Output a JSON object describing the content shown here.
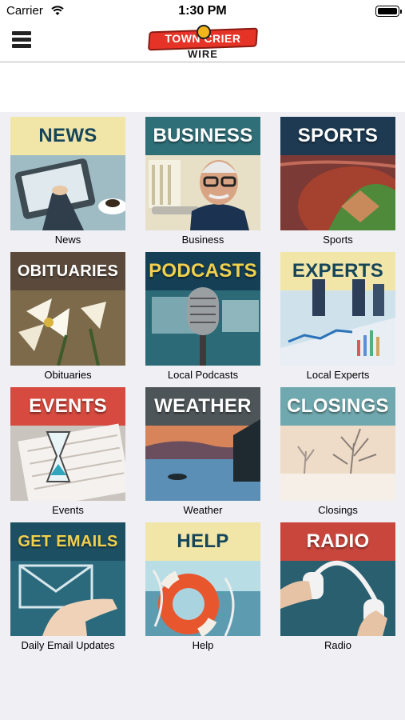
{
  "status_bar": {
    "carrier": "Carrier",
    "time": "1:30 PM"
  },
  "header": {
    "logo_top": "TOWN CRIER",
    "logo_bottom": "WIRE"
  },
  "tiles": [
    {
      "title": "NEWS",
      "label": "News"
    },
    {
      "title": "BUSINESS",
      "label": "Business"
    },
    {
      "title": "SPORTS",
      "label": "Sports"
    },
    {
      "title": "OBITUARIES",
      "label": "Obituaries"
    },
    {
      "title": "PODCASTS",
      "label": "Local Podcasts"
    },
    {
      "title": "EXPERTS",
      "label": "Local Experts"
    },
    {
      "title": "EVENTS",
      "label": "Events"
    },
    {
      "title": "WEATHER",
      "label": "Weather"
    },
    {
      "title": "CLOSINGS",
      "label": "Closings"
    },
    {
      "title": "GET EMAILS",
      "label": "Daily Email Updates"
    },
    {
      "title": "HELP",
      "label": "Help"
    },
    {
      "title": "RADIO",
      "label": "Radio"
    }
  ],
  "icons": {
    "menu": "hamburger-menu-icon",
    "wifi": "wifi-icon",
    "battery": "battery-icon"
  },
  "colors": {
    "logo_red": "#e53427",
    "logo_gold": "#f2b51c",
    "background": "#efeff4"
  }
}
